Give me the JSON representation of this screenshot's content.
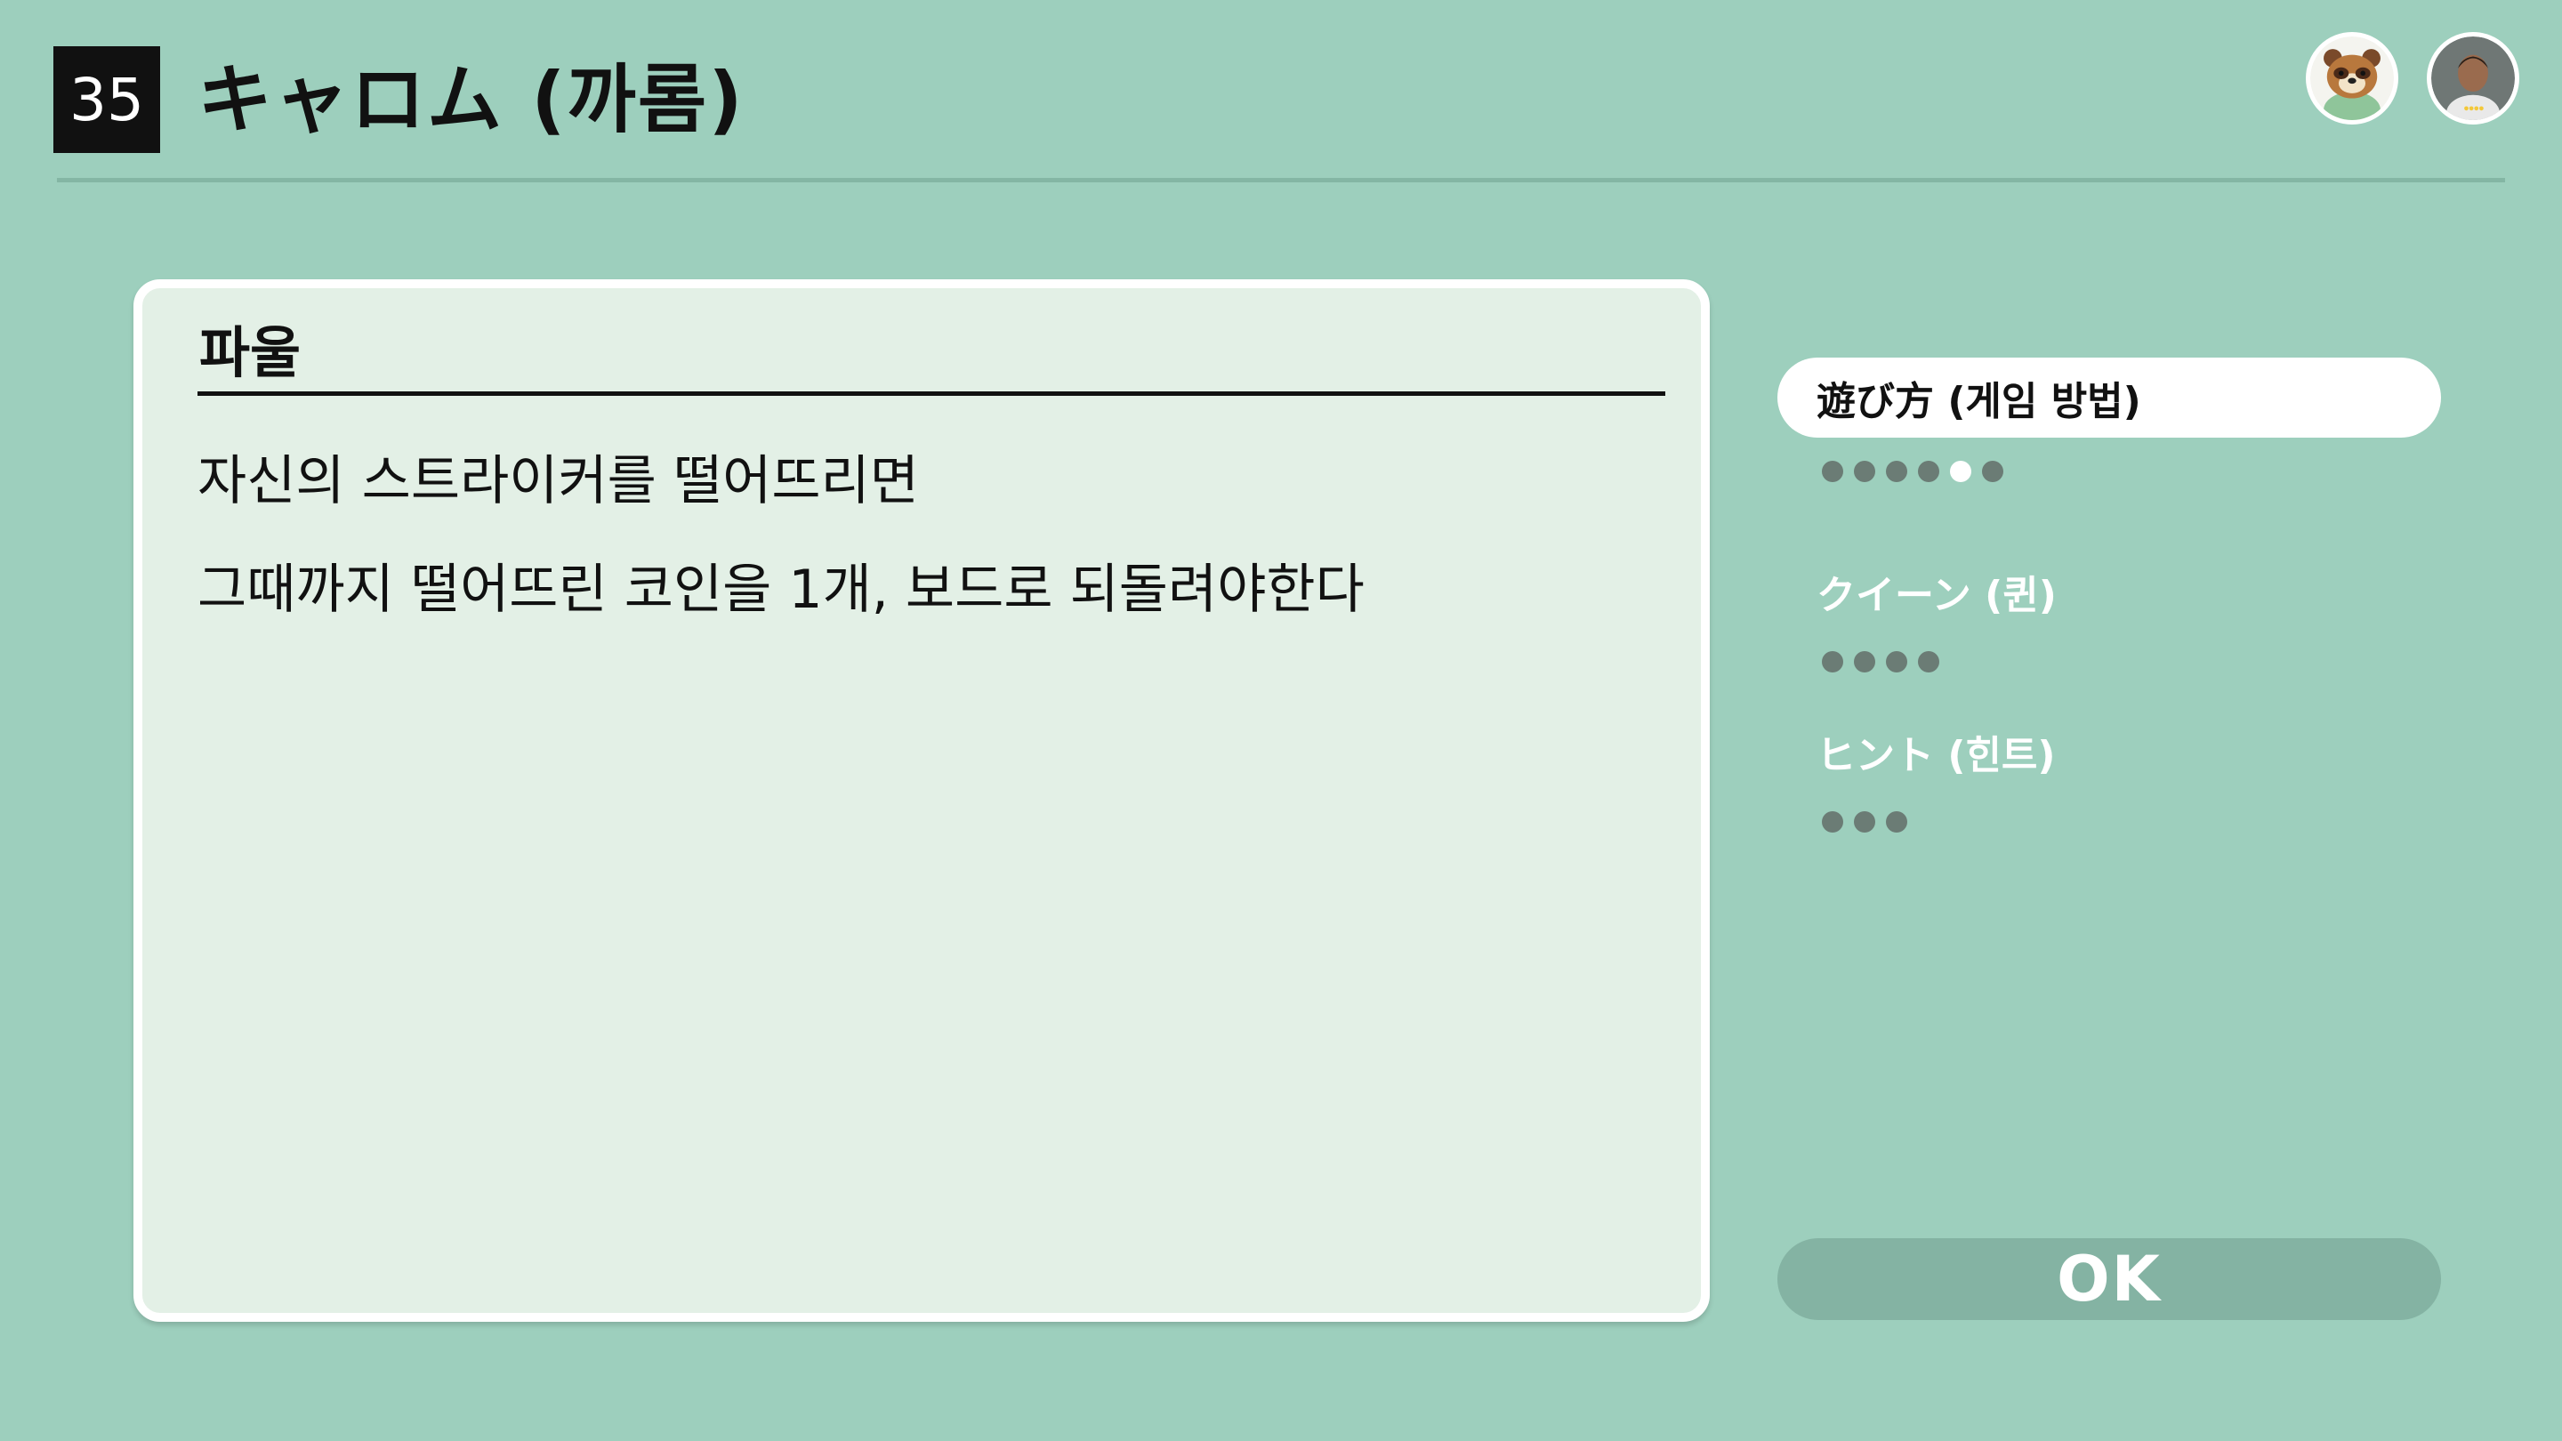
{
  "header": {
    "number": "35",
    "title": "キャロム (까롬)"
  },
  "avatars": [
    {
      "icon": "tanuki-character-icon"
    },
    {
      "icon": "user-avatar-icon"
    }
  ],
  "panel": {
    "title": "파울",
    "lines": [
      "자신의 스트라이커를 떨어뜨리면",
      "그때까지 떨어뜨린 코인을 1개, 보드로 되돌려야한다"
    ]
  },
  "menu": {
    "items": [
      {
        "label": "遊び方 (게임 방법)",
        "pages": 6,
        "current_page": 5,
        "selected": true
      },
      {
        "label": "クイーン (퀸)",
        "pages": 4,
        "selected": false
      },
      {
        "label": "ヒント (힌트)",
        "pages": 3,
        "selected": false
      }
    ]
  },
  "ok_button": {
    "label": "OK"
  },
  "colors": {
    "background": "#9dcfbd",
    "panel": "#e3f0e6",
    "dot": "#6b7c75",
    "ok_button": "#84b3a3"
  }
}
